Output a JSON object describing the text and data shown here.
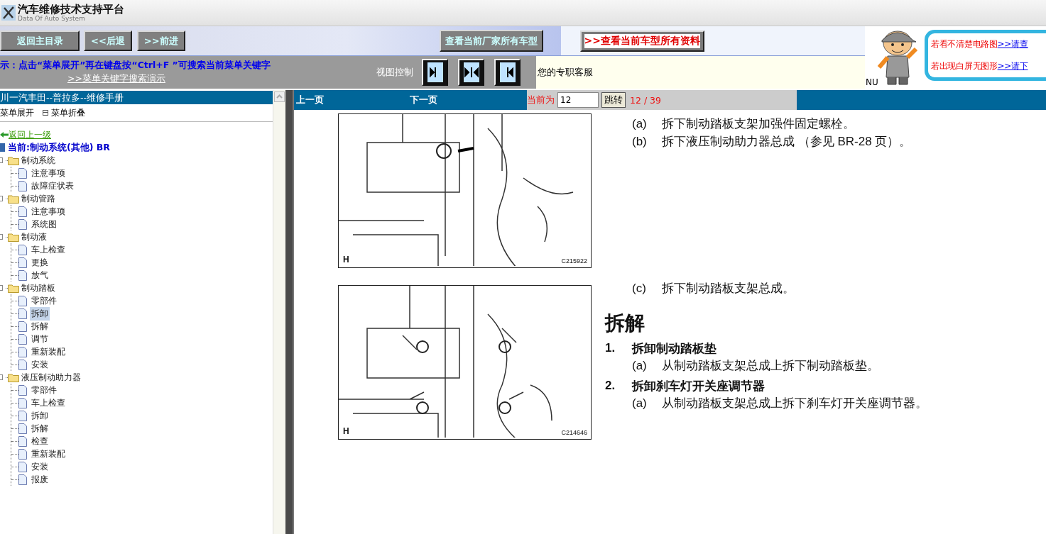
{
  "app": {
    "title": "汽车维修技术支持平台",
    "subtitle": "Data Of Auto System"
  },
  "nav_buttons": [
    {
      "label": "返回主目录"
    },
    {
      "label": "<<后退"
    },
    {
      "label": ">>前进"
    }
  ],
  "maker_button": "查看当前厂家所有车型",
  "model_button": ">>查看当前车型所有资料",
  "hint": {
    "text": "示：点击“菜单展开”再在键盘按“Ctrl+F ”可搜索当前菜单关键字",
    "link": ">>菜单关键字搜索演示"
  },
  "view_control": {
    "label": "视图控制",
    "buttons": [
      {
        "kind": "right"
      },
      {
        "kind": "both"
      },
      {
        "kind": "left"
      }
    ]
  },
  "service_text": "您的专职客服",
  "nu_text": "NU",
  "notices": [
    {
      "text": "若看不清楚电路图",
      "link": ">>请查"
    },
    {
      "text": "若出现白屏无图形",
      "link": ">>请下"
    }
  ],
  "manual": {
    "title": "川一汽丰田--普拉多--维修手册",
    "expand": "菜单展开",
    "collapse": "菜单折叠",
    "back": "返回上一级",
    "current": "当前:制动系统(其他) BR"
  },
  "tree": [
    {
      "label": "制动系统",
      "selected": false,
      "children": [
        {
          "label": "注意事项",
          "selected": false
        },
        {
          "label": "故障症状表",
          "selected": false
        }
      ]
    },
    {
      "label": "制动管路",
      "selected": false,
      "children": [
        {
          "label": "注意事项",
          "selected": false
        },
        {
          "label": "系统图",
          "selected": false
        }
      ]
    },
    {
      "label": "制动液",
      "selected": false,
      "children": [
        {
          "label": "车上检查",
          "selected": false
        },
        {
          "label": "更换",
          "selected": false
        },
        {
          "label": "放气",
          "selected": false
        }
      ]
    },
    {
      "label": "制动踏板",
      "selected": false,
      "children": [
        {
          "label": "零部件",
          "selected": false
        },
        {
          "label": "拆卸",
          "selected": true
        },
        {
          "label": "拆解",
          "selected": false
        },
        {
          "label": "调节",
          "selected": false
        },
        {
          "label": "重新装配",
          "selected": false
        },
        {
          "label": "安装",
          "selected": false
        }
      ]
    },
    {
      "label": "液压制动助力器",
      "selected": false,
      "children": [
        {
          "label": "零部件",
          "selected": false
        },
        {
          "label": "车上检查",
          "selected": false
        },
        {
          "label": "拆卸",
          "selected": false
        },
        {
          "label": "拆解",
          "selected": false
        },
        {
          "label": "检查",
          "selected": false
        },
        {
          "label": "重新装配",
          "selected": false
        },
        {
          "label": "安装",
          "selected": false
        },
        {
          "label": "报废",
          "selected": false
        }
      ]
    }
  ],
  "pager": {
    "prev": "上一页",
    "next": "下一页",
    "current_label": "当前为",
    "page_value": "12",
    "jump": "跳转",
    "position": "12 / 39"
  },
  "document": {
    "figures": [
      {
        "corner": "H",
        "code": "C215922"
      },
      {
        "corner": "H",
        "code": "C214646"
      }
    ],
    "steps_top": [
      {
        "marker": "(a)",
        "text": "拆下制动踏板支架加强件固定螺栓。"
      },
      {
        "marker": "(b)",
        "text": "拆下液压制动助力器总成 （参见 BR-28 页）。"
      }
    ],
    "step_c": {
      "marker": "(c)",
      "text": "拆下制动踏板支架总成。"
    },
    "section_title": "拆解",
    "sections": [
      {
        "number": "1.",
        "title": "拆卸制动踏板垫",
        "items": [
          {
            "marker": "(a)",
            "text": "从制动踏板支架总成上拆下制动踏板垫。"
          }
        ]
      },
      {
        "number": "2.",
        "title": "拆卸刹车灯开关座调节器",
        "items": [
          {
            "marker": "(a)",
            "text": "从制动踏板支架总成上拆下刹车灯开关座调节器。"
          }
        ]
      }
    ]
  }
}
